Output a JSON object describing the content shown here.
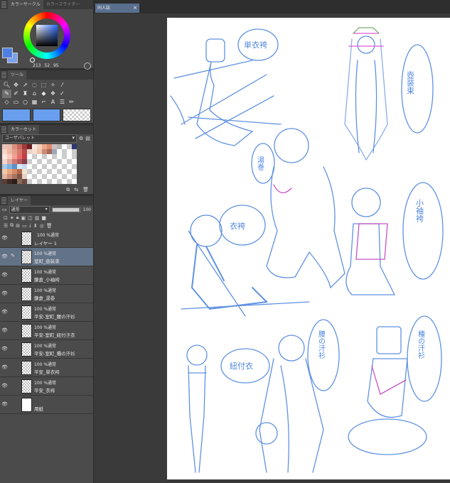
{
  "panels": {
    "color_tabs": [
      "カラーサークル",
      "カラースライダー"
    ],
    "tool_tab": "ツール",
    "colorset_tab": "カラーセット",
    "layer_tab": "レイヤー"
  },
  "color": {
    "h_label": "213",
    "s_label": "52",
    "v_label": "95",
    "main": "#4f7fe0",
    "sub": "#7aa2ee"
  },
  "palette": {
    "selected": "ユーザパレット",
    "colors": [
      "#e7c3b7",
      "#e9b9ab",
      "#d99080",
      "#c46a5f",
      "#9d3b3a",
      "#6e1d22",
      "#f4e6df",
      "#f8cdb9",
      "#eaa98c",
      "#dd8b6f",
      "#cfc0c0",
      "#b5b5b5",
      "#ffffff",
      "#cccccc",
      "#2e3572",
      "#f6d4c8",
      "#f0b8a5",
      "#e49d8c",
      "#d7786a",
      "#b84b49",
      "#e7d3c8",
      "#f7ddd0",
      "#f0c3ac",
      "#cc8b78",
      "#a56a5c",
      "#9ea7b8",
      "#ffffff",
      "#cccccc",
      "#ffffff",
      "#cccccc",
      "#fde6da",
      "#f9cbbb",
      "#ef9f95",
      "#e66e6c",
      "#c13f49",
      "#ffffff",
      "#cccccc",
      "#ffffff",
      "#cccccc",
      "#ffffff",
      "#cccccc",
      "#ffffff",
      "#cccccc",
      "#ffffff",
      "#cccccc",
      "#f2d6cb",
      "#e2a69a",
      "#cf7a74",
      "#b55b5d",
      "#8a3c46",
      "#cccccc",
      "#ffffff",
      "#cccccc",
      "#ffffff",
      "#cccccc",
      "#ffffff",
      "#cccccc",
      "#ffffff",
      "#cccccc",
      "#ffffff",
      "#a8c8e8",
      "#7fb2e0",
      "#5d8fc8",
      "#d9e8f7",
      "#c7d9f0",
      "#ffffff",
      "#cccccc",
      "#ffffff",
      "#cccccc",
      "#ffffff",
      "#cccccc",
      "#ffffff",
      "#cccccc",
      "#ffffff",
      "#cccccc",
      "#f3c9a8",
      "#e8a880",
      "#d58b68",
      "#b06a4e",
      "#f2e4d2",
      "#cccccc",
      "#ffffff",
      "#cccccc",
      "#ffffff",
      "#cccccc",
      "#ffffff",
      "#cccccc",
      "#ffffff",
      "#cccccc",
      "#ffffff",
      "#e0b5a0",
      "#c98f7a",
      "#a8725f",
      "#7d5446",
      "#e6d2c2",
      "#ffffff",
      "#cccccc",
      "#ffffff",
      "#cccccc",
      "#ffffff",
      "#cccccc",
      "#ffffff",
      "#cccccc",
      "#ffffff",
      "#cccccc",
      "#5a3d35",
      "#3d2a25",
      "#2a1d1a",
      "#8b6a5a",
      "#6b4c40",
      "#cccccc",
      "#ffffff",
      "#cccccc",
      "#ffffff",
      "#cccccc",
      "#ffffff",
      "#cccccc",
      "#ffffff",
      "#cccccc",
      "#ffffff"
    ]
  },
  "layer_controls": {
    "blend": "通常",
    "opacity": "100"
  },
  "layers": [
    {
      "mode": "100 %通常",
      "name": "レイヤー 1",
      "folder": true,
      "selected": false,
      "paper": false
    },
    {
      "mode": "100 %通常",
      "name": "室町_壺装束",
      "folder": false,
      "selected": true,
      "paper": false
    },
    {
      "mode": "100 %通常",
      "name": "鎌倉_小袖袴",
      "folder": false,
      "selected": false,
      "paper": false
    },
    {
      "mode": "100 %通常",
      "name": "鎌倉_湯巻",
      "folder": false,
      "selected": false,
      "paper": false
    },
    {
      "mode": "100 %通常",
      "name": "平安-室町_腰の汗衫",
      "folder": false,
      "selected": false,
      "paper": false
    },
    {
      "mode": "100 %通常",
      "name": "平安-室町_紐付き衣",
      "folder": false,
      "selected": false,
      "paper": false
    },
    {
      "mode": "100 %通常",
      "name": "平安-室町_種の汗衫",
      "folder": false,
      "selected": false,
      "paper": false
    },
    {
      "mode": "100 %通常",
      "name": "平安_単衣袴",
      "folder": false,
      "selected": false,
      "paper": false
    },
    {
      "mode": "100 %通常",
      "name": "平安_衣袴",
      "folder": false,
      "selected": false,
      "paper": false
    },
    {
      "mode": "",
      "name": "用紙",
      "folder": false,
      "selected": false,
      "paper": true
    }
  ],
  "document_tab": "同人誌",
  "sketch_labels": [
    "単衣袴",
    "壺装束",
    "湯巻",
    "衣袴",
    "小袖袴",
    "紐付衣",
    "腰の汗衫",
    "種の汗衫"
  ]
}
